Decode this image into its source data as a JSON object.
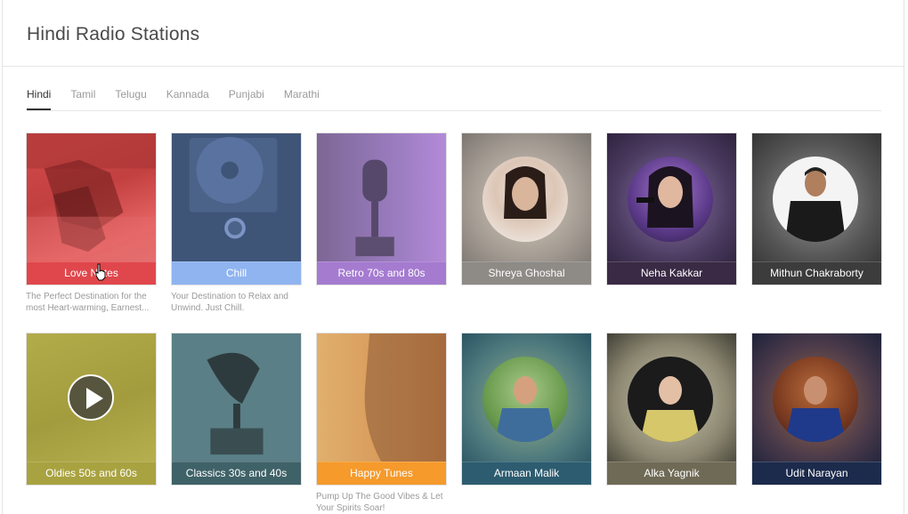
{
  "page": {
    "title": "Hindi Radio Stations"
  },
  "tabs": [
    {
      "label": "Hindi",
      "active": true
    },
    {
      "label": "Tamil"
    },
    {
      "label": "Telugu"
    },
    {
      "label": "Kannada"
    },
    {
      "label": "Punjabi"
    },
    {
      "label": "Marathi"
    }
  ],
  "stations": [
    {
      "name": "Love Notes",
      "description": "The Perfect Destination for the most Heart-warming, Earnest...",
      "bar_color": "#e0474c"
    },
    {
      "name": "Chill",
      "description": "Your Destination to Relax and Unwind. Just Chill.",
      "bar_color": "#8fb4f0"
    },
    {
      "name": "Retro 70s and 80s",
      "description": "",
      "bar_color": "#a57bd0"
    },
    {
      "name": "Shreya Ghoshal",
      "description": "",
      "bar_color": "#8e8a86"
    },
    {
      "name": "Neha Kakkar",
      "description": "",
      "bar_color": "#3a2a45"
    },
    {
      "name": "Mithun Chakraborty",
      "description": "",
      "bar_color": "#3c3c3c"
    },
    {
      "name": "Oldies 50s and 60s",
      "description": "",
      "bar_color": "#a9a240"
    },
    {
      "name": "Classics 30s and 40s",
      "description": "",
      "bar_color": "#3f6268"
    },
    {
      "name": "Happy Tunes",
      "description": "Pump Up The Good Vibes & Let Your Spirits Soar!",
      "bar_color": "#f59a2b"
    },
    {
      "name": "Armaan Malik",
      "description": "",
      "bar_color": "#2d5c70"
    },
    {
      "name": "Alka Yagnik",
      "description": "",
      "bar_color": "#6f6a55"
    },
    {
      "name": "Udit Narayan",
      "description": "",
      "bar_color": "#1c2a4c"
    }
  ]
}
